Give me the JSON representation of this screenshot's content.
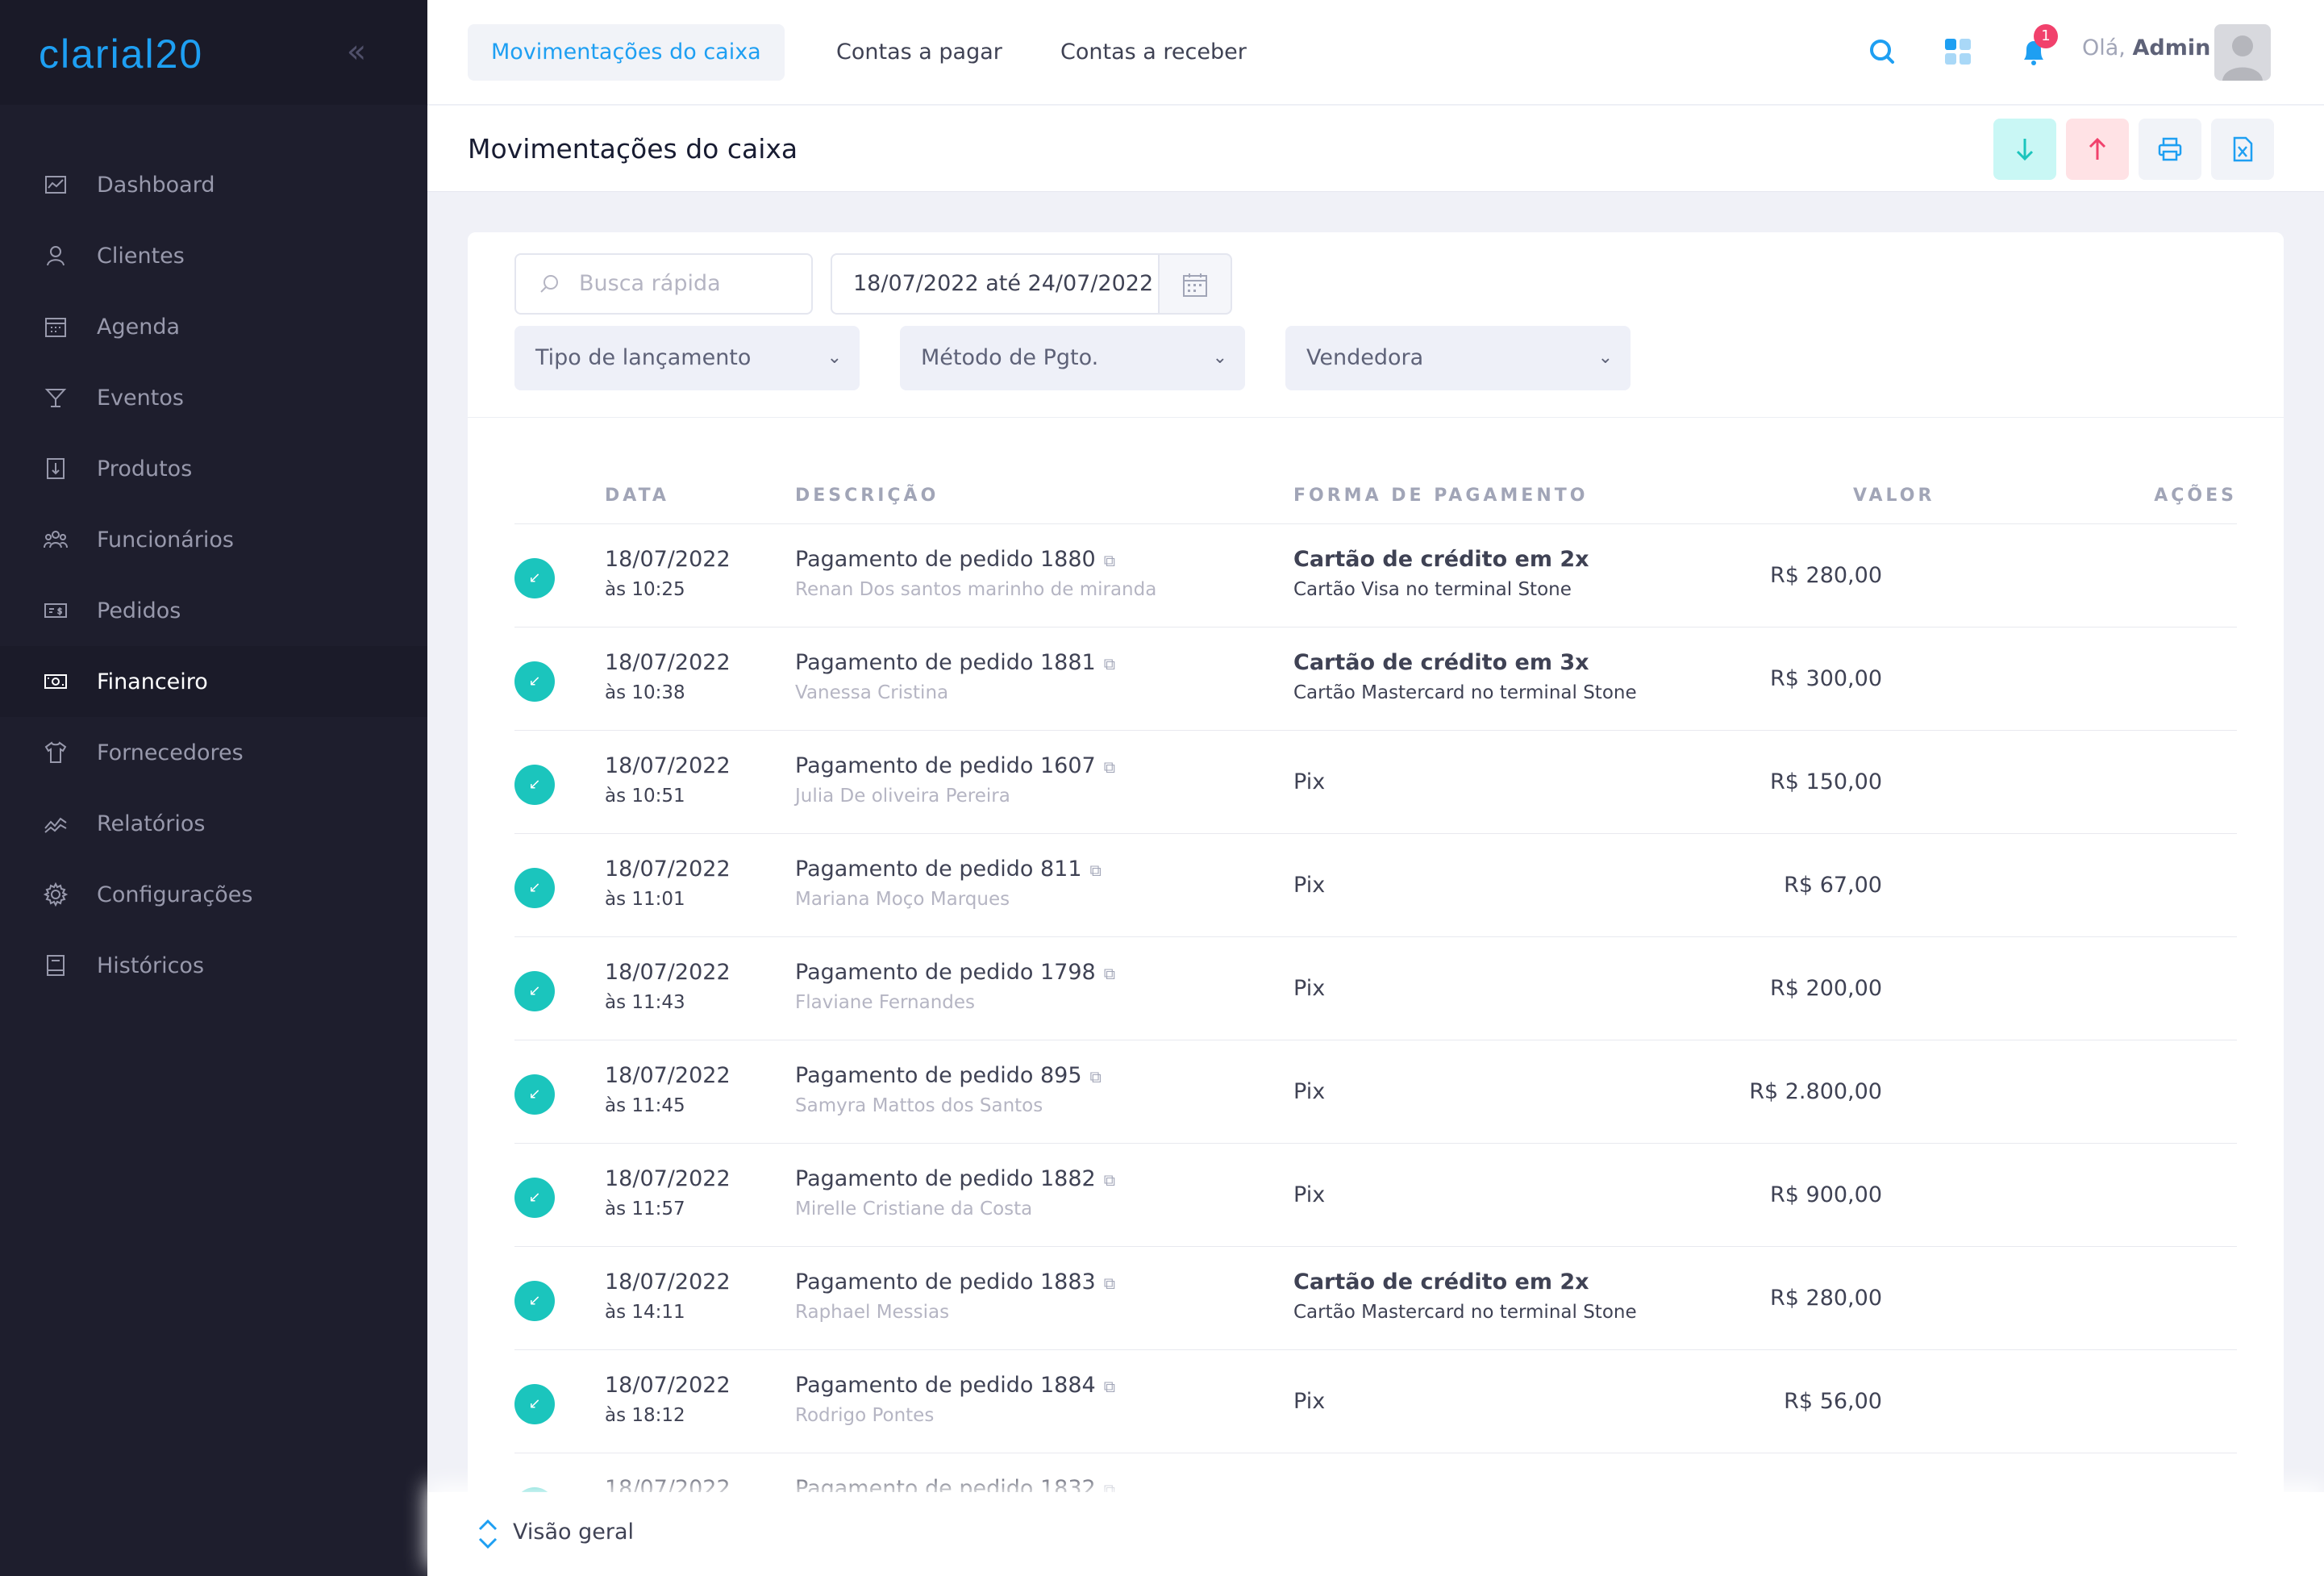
{
  "brand": {
    "logo_text": "clarial20"
  },
  "sidebar": {
    "items": [
      {
        "label": "Dashboard",
        "icon": "chart-icon"
      },
      {
        "label": "Clientes",
        "icon": "user-icon"
      },
      {
        "label": "Agenda",
        "icon": "calendar-icon"
      },
      {
        "label": "Eventos",
        "icon": "cocktail-icon"
      },
      {
        "label": "Produtos",
        "icon": "product-icon"
      },
      {
        "label": "Funcionários",
        "icon": "team-icon"
      },
      {
        "label": "Pedidos",
        "icon": "money-icon"
      },
      {
        "label": "Financeiro",
        "icon": "cash-icon",
        "active": true
      },
      {
        "label": "Fornecedores",
        "icon": "shirt-icon"
      },
      {
        "label": "Relatórios",
        "icon": "trend-icon"
      },
      {
        "label": "Configurações",
        "icon": "gear-icon"
      },
      {
        "label": "Históricos",
        "icon": "book-icon"
      }
    ]
  },
  "topbar": {
    "tabs": [
      {
        "label": "Movimentações do caixa",
        "active": true
      },
      {
        "label": "Contas a pagar"
      },
      {
        "label": "Contas a receber"
      }
    ],
    "notifications_count": "1",
    "greeting": "Olá,",
    "user": "Admin"
  },
  "page": {
    "title": "Movimentações do caixa"
  },
  "filters": {
    "search_placeholder": "Busca rápida",
    "date_range": "18/07/2022 até 24/07/2022",
    "type_select": "Tipo de lançamento",
    "method_select": "Método de Pgto.",
    "seller_select": "Vendedora"
  },
  "table": {
    "headers": {
      "date": "DATA",
      "desc": "DESCRIÇÃO",
      "payment": "FORMA DE PAGAMENTO",
      "value": "VALOR",
      "actions": "AÇÕES"
    },
    "rows": [
      {
        "date": "18/07/2022",
        "time": "às 10:25",
        "desc": "Pagamento de pedido 1880",
        "client": "Renan Dos santos marinho de miranda",
        "payment": "Cartão de crédito em 2x",
        "payment_detail": "Cartão Visa no terminal Stone",
        "value": "R$ 280,00"
      },
      {
        "date": "18/07/2022",
        "time": "às 10:38",
        "desc": "Pagamento de pedido 1881",
        "client": "Vanessa Cristina",
        "payment": "Cartão de crédito em 3x",
        "payment_detail": "Cartão Mastercard no terminal Stone",
        "value": "R$ 300,00"
      },
      {
        "date": "18/07/2022",
        "time": "às 10:51",
        "desc": "Pagamento de pedido 1607",
        "client": "Julia De oliveira Pereira",
        "payment": "Pix",
        "payment_detail": "",
        "value": "R$ 150,00"
      },
      {
        "date": "18/07/2022",
        "time": "às 11:01",
        "desc": "Pagamento de pedido 811",
        "client": "Mariana Moço Marques",
        "payment": "Pix",
        "payment_detail": "",
        "value": "R$ 67,00"
      },
      {
        "date": "18/07/2022",
        "time": "às 11:43",
        "desc": "Pagamento de pedido 1798",
        "client": "Flaviane Fernandes",
        "payment": "Pix",
        "payment_detail": "",
        "value": "R$ 200,00"
      },
      {
        "date": "18/07/2022",
        "time": "às 11:45",
        "desc": "Pagamento de pedido 895",
        "client": "Samyra Mattos dos Santos",
        "payment": "Pix",
        "payment_detail": "",
        "value": "R$ 2.800,00"
      },
      {
        "date": "18/07/2022",
        "time": "às 11:57",
        "desc": "Pagamento de pedido 1882",
        "client": "Mirelle Cristiane da Costa",
        "payment": "Pix",
        "payment_detail": "",
        "value": "R$ 900,00"
      },
      {
        "date": "18/07/2022",
        "time": "às 14:11",
        "desc": "Pagamento de pedido 1883",
        "client": "Raphael Messias",
        "payment": "Cartão de crédito em 2x",
        "payment_detail": "Cartão Mastercard no terminal Stone",
        "value": "R$ 280,00"
      },
      {
        "date": "18/07/2022",
        "time": "às 18:12",
        "desc": "Pagamento de pedido 1884",
        "client": "Rodrigo Pontes",
        "payment": "Pix",
        "payment_detail": "",
        "value": "R$ 56,00"
      },
      {
        "date": "18/07/2022",
        "time": "",
        "desc": "Pagamento de pedido 1832",
        "client": "",
        "payment": "",
        "payment_detail": "",
        "value": ""
      }
    ]
  },
  "bottom": {
    "label": "Visão geral"
  },
  "colors": {
    "accent": "#1e9ff2",
    "success": "#1bc5bd",
    "danger": "#f1416c",
    "sidebar": "#1e1e2d"
  }
}
